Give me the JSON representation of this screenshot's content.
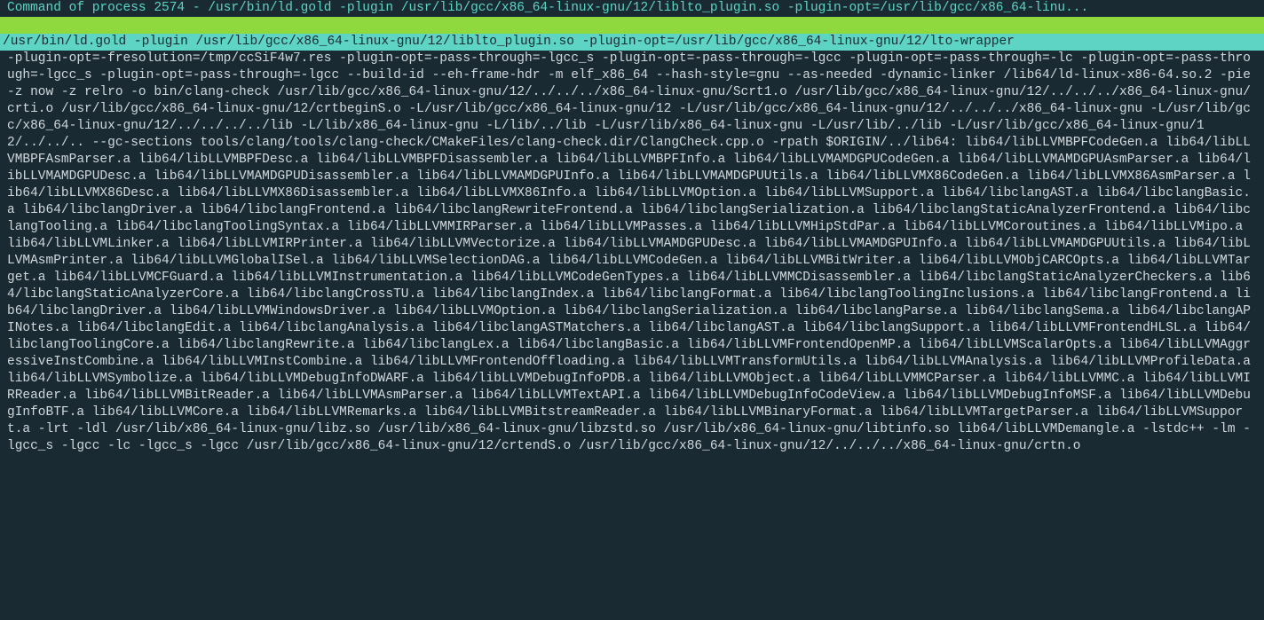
{
  "title": "Command of process 2574 - /usr/bin/ld.gold -plugin /usr/lib/gcc/x86_64-linux-gnu/12/liblto_plugin.so -plugin-opt=/usr/lib/gcc/x86_64-linu...",
  "highlighted_line": "/usr/bin/ld.gold -plugin /usr/lib/gcc/x86_64-linux-gnu/12/liblto_plugin.so -plugin-opt=/usr/lib/gcc/x86_64-linux-gnu/12/lto-wrapper",
  "body": "-plugin-opt=-fresolution=/tmp/ccSiF4w7.res -plugin-opt=-pass-through=-lgcc_s -plugin-opt=-pass-through=-lgcc -plugin-opt=-pass-through=-lc -plugin-opt=-pass-through=-lgcc_s -plugin-opt=-pass-through=-lgcc --build-id --eh-frame-hdr -m elf_x86_64 --hash-style=gnu --as-needed -dynamic-linker /lib64/ld-linux-x86-64.so.2 -pie -z now -z relro -o bin/clang-check /usr/lib/gcc/x86_64-linux-gnu/12/../../../x86_64-linux-gnu/Scrt1.o /usr/lib/gcc/x86_64-linux-gnu/12/../../../x86_64-linux-gnu/crti.o /usr/lib/gcc/x86_64-linux-gnu/12/crtbeginS.o -L/usr/lib/gcc/x86_64-linux-gnu/12 -L/usr/lib/gcc/x86_64-linux-gnu/12/../../../x86_64-linux-gnu -L/usr/lib/gcc/x86_64-linux-gnu/12/../../../../lib -L/lib/x86_64-linux-gnu -L/lib/../lib -L/usr/lib/x86_64-linux-gnu -L/usr/lib/../lib -L/usr/lib/gcc/x86_64-linux-gnu/12/../../.. --gc-sections tools/clang/tools/clang-check/CMakeFiles/clang-check.dir/ClangCheck.cpp.o -rpath $ORIGIN/../lib64: lib64/libLLVMBPFCodeGen.a lib64/libLLVMBPFAsmParser.a lib64/libLLVMBPFDesc.a lib64/libLLVMBPFDisassembler.a lib64/libLLVMBPFInfo.a lib64/libLLVMAMDGPUCodeGen.a lib64/libLLVMAMDGPUAsmParser.a lib64/libLLVMAMDGPUDesc.a lib64/libLLVMAMDGPUDisassembler.a lib64/libLLVMAMDGPUInfo.a lib64/libLLVMAMDGPUUtils.a lib64/libLLVMX86CodeGen.a lib64/libLLVMX86AsmParser.a lib64/libLLVMX86Desc.a lib64/libLLVMX86Disassembler.a lib64/libLLVMX86Info.a lib64/libLLVMOption.a lib64/libLLVMSupport.a lib64/libclangAST.a lib64/libclangBasic.a lib64/libclangDriver.a lib64/libclangFrontend.a lib64/libclangRewriteFrontend.a lib64/libclangSerialization.a lib64/libclangStaticAnalyzerFrontend.a lib64/libclangTooling.a lib64/libclangToolingSyntax.a lib64/libLLVMMIRParser.a lib64/libLLVMPasses.a lib64/libLLVMHipStdPar.a lib64/libLLVMCoroutines.a lib64/libLLVMipo.a lib64/libLLVMLinker.a lib64/libLLVMIRPrinter.a lib64/libLLVMVectorize.a lib64/libLLVMAMDGPUDesc.a lib64/libLLVMAMDGPUInfo.a lib64/libLLVMAMDGPUUtils.a lib64/libLLVMAsmPrinter.a lib64/libLLVMGlobalISel.a lib64/libLLVMSelectionDAG.a lib64/libLLVMCodeGen.a lib64/libLLVMBitWriter.a lib64/libLLVMObjCARCOpts.a lib64/libLLVMTarget.a lib64/libLLVMCFGuard.a lib64/libLLVMInstrumentation.a lib64/libLLVMCodeGenTypes.a lib64/libLLVMMCDisassembler.a lib64/libclangStaticAnalyzerCheckers.a lib64/libclangStaticAnalyzerCore.a lib64/libclangCrossTU.a lib64/libclangIndex.a lib64/libclangFormat.a lib64/libclangToolingInclusions.a lib64/libclangFrontend.a lib64/libclangDriver.a lib64/libLLVMWindowsDriver.a lib64/libLLVMOption.a lib64/libclangSerialization.a lib64/libclangParse.a lib64/libclangSema.a lib64/libclangAPINotes.a lib64/libclangEdit.a lib64/libclangAnalysis.a lib64/libclangASTMatchers.a lib64/libclangAST.a lib64/libclangSupport.a lib64/libLLVMFrontendHLSL.a lib64/libclangToolingCore.a lib64/libclangRewrite.a lib64/libclangLex.a lib64/libclangBasic.a lib64/libLLVMFrontendOpenMP.a lib64/libLLVMScalarOpts.a lib64/libLLVMAggressiveInstCombine.a lib64/libLLVMInstCombine.a lib64/libLLVMFrontendOffloading.a lib64/libLLVMTransformUtils.a lib64/libLLVMAnalysis.a lib64/libLLVMProfileData.a lib64/libLLVMSymbolize.a lib64/libLLVMDebugInfoDWARF.a lib64/libLLVMDebugInfoPDB.a lib64/libLLVMObject.a lib64/libLLVMMCParser.a lib64/libLLVMMC.a lib64/libLLVMIRReader.a lib64/libLLVMBitReader.a lib64/libLLVMAsmParser.a lib64/libLLVMTextAPI.a lib64/libLLVMDebugInfoCodeView.a lib64/libLLVMDebugInfoMSF.a lib64/libLLVMDebugInfoBTF.a lib64/libLLVMCore.a lib64/libLLVMRemarks.a lib64/libLLVMBitstreamReader.a lib64/libLLVMBinaryFormat.a lib64/libLLVMTargetParser.a lib64/libLLVMSupport.a -lrt -ldl /usr/lib/x86_64-linux-gnu/libz.so /usr/lib/x86_64-linux-gnu/libzstd.so /usr/lib/x86_64-linux-gnu/libtinfo.so lib64/libLLVMDemangle.a -lstdc++ -lm -lgcc_s -lgcc -lc -lgcc_s -lgcc /usr/lib/gcc/x86_64-linux-gnu/12/crtendS.o /usr/lib/gcc/x86_64-linux-gnu/12/../../../x86_64-linux-gnu/crtn.o"
}
